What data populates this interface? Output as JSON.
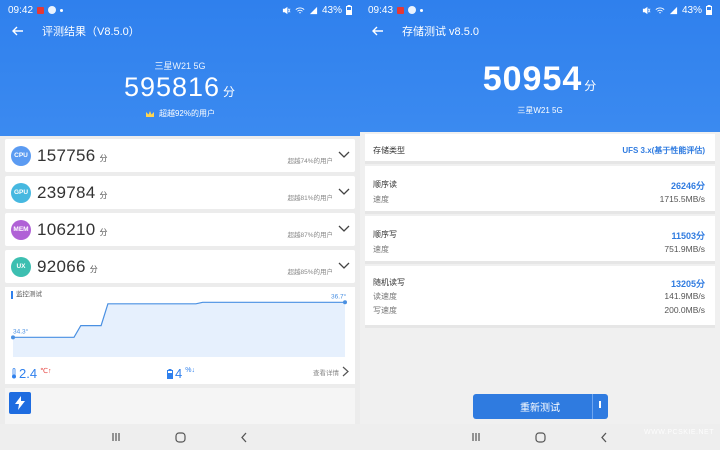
{
  "colors": {
    "primary": "#2f80ed",
    "cpu": "#5b9bf2",
    "gpu": "#46b8e0",
    "mem": "#b061d6",
    "ux": "#3dbfb1",
    "temp_line": "#4a90e2"
  },
  "left": {
    "status": {
      "time": "09:42",
      "battery": "43%"
    },
    "header": {
      "title": "评测结果（V8.5.0）"
    },
    "hero": {
      "model": "三星W21 5G",
      "total": "595816",
      "unit": "分",
      "rank": "超越92%的用户"
    },
    "scores": [
      {
        "chip": "CPU",
        "score": "157756",
        "unit": "分",
        "percent": "超越74%的用户",
        "color_key": "cpu"
      },
      {
        "chip": "GPU",
        "score": "239784",
        "unit": "分",
        "percent": "超越81%的用户",
        "color_key": "gpu"
      },
      {
        "chip": "MEM",
        "score": "106210",
        "unit": "分",
        "percent": "超越87%的用户",
        "color_key": "mem"
      },
      {
        "chip": "UX",
        "score": "92066",
        "unit": "分",
        "percent": "超越85%的用户",
        "color_key": "ux"
      }
    ],
    "temperature": {
      "title": "监控测试",
      "start_label": "34.3°",
      "end_label": "36.7°",
      "temp_rise": "2.4",
      "temp_unit": "℃↑",
      "battery_drop": "4",
      "battery_unit": "%↓",
      "details_label": "查看详情",
      "series": [
        34.3,
        34.3,
        34.3,
        34.3,
        34.3,
        34.3,
        34.3,
        34.3,
        34.3,
        34.3,
        35.1,
        35.1,
        35.1,
        35.1,
        36.6,
        36.6,
        36.6,
        36.6,
        36.6,
        36.6,
        36.6,
        36.6,
        36.6,
        36.6,
        36.6,
        36.6,
        36.6,
        36.6,
        36.7,
        36.7,
        36.7,
        36.7,
        36.7,
        36.7,
        36.7,
        36.7,
        36.7,
        36.7,
        36.7,
        36.7,
        36.7,
        36.7,
        36.7,
        36.7,
        36.7,
        36.7,
        36.7,
        36.7,
        36.7,
        36.7
      ],
      "y_range": [
        33.5,
        37.2
      ]
    }
  },
  "right": {
    "status": {
      "time": "09:43",
      "battery": "43%"
    },
    "header": {
      "title": "存储测试 v8.5.0"
    },
    "hero": {
      "total": "50954",
      "unit": "分",
      "model": "三星W21 5G"
    },
    "storage_type": {
      "label": "存储类型",
      "value": "UFS 3.x(基于性能评估)"
    },
    "seq_read": {
      "label": "顺序读",
      "score": "26246分",
      "speed_label": "速度",
      "speed": "1715.5MB/s"
    },
    "seq_write": {
      "label": "顺序写",
      "score": "11503分",
      "speed_label": "速度",
      "speed": "751.9MB/s"
    },
    "random": {
      "label": "随机读写",
      "score": "13205分",
      "read_label": "读速度",
      "read_speed": "141.9MB/s",
      "write_label": "写速度",
      "write_speed": "200.0MB/s"
    },
    "retest_label": "重新测试",
    "watermark": "WWW.PCSKIE.NET"
  }
}
